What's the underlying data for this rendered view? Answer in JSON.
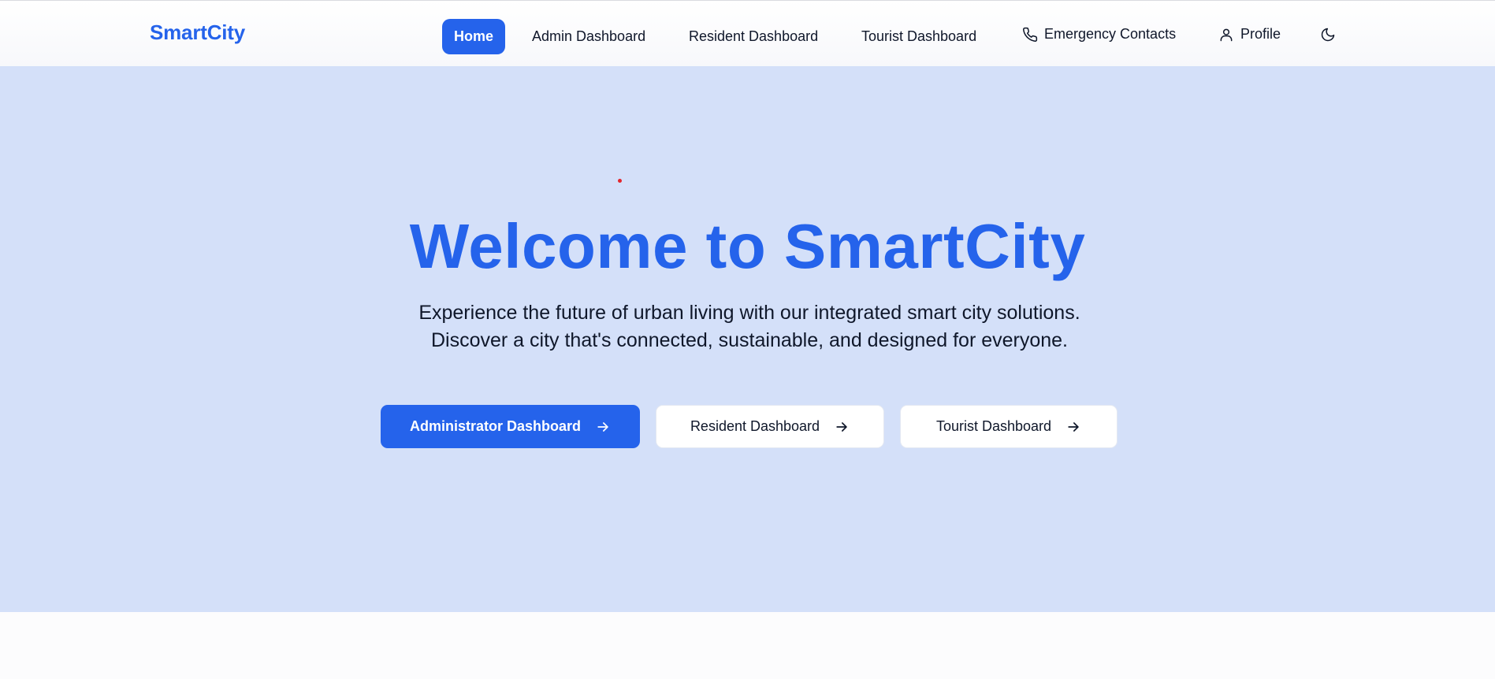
{
  "brand": "SmartCity",
  "nav": {
    "home": "Home",
    "admin": "Admin Dashboard",
    "resident": "Resident Dashboard",
    "tourist": "Tourist Dashboard",
    "emergency": "Emergency Contacts",
    "profile": "Profile",
    "icons": {
      "emergency": "phone-icon",
      "profile": "user-icon",
      "theme": "moon-icon"
    }
  },
  "hero": {
    "title": "Welcome to SmartCity",
    "subtitle": "Experience the future of urban living with our integrated smart city solutions. Discover a city that's connected, sustainable, and designed for everyone.",
    "buttons": {
      "admin": "Administrator Dashboard",
      "resident": "Resident Dashboard",
      "tourist": "Tourist Dashboard",
      "icon": "arrow-right-icon"
    }
  },
  "colors": {
    "accent": "#2563eb",
    "hero_background": "#d4e0f9",
    "text": "#0f172a",
    "dot": "#e3262d"
  }
}
